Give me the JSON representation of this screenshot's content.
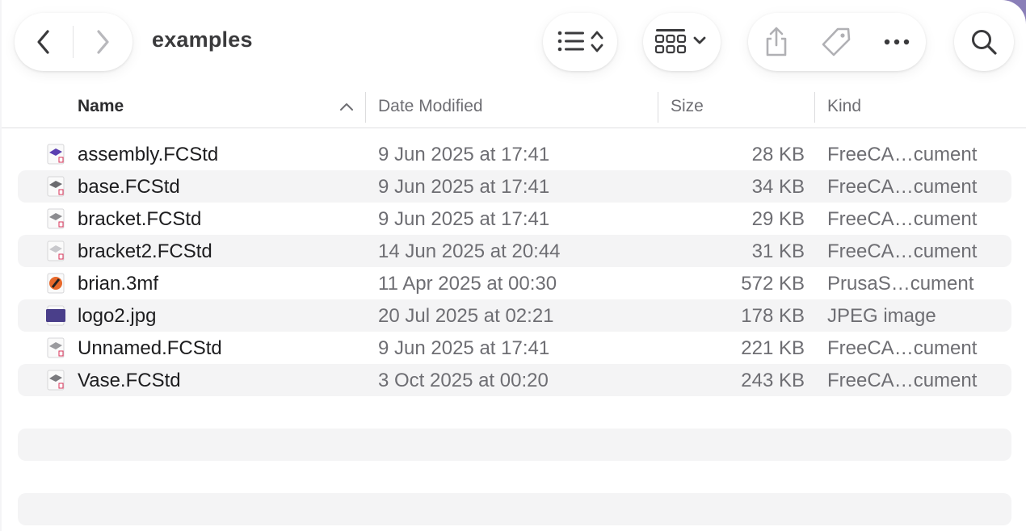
{
  "window": {
    "title": "examples"
  },
  "toolbar": {
    "back_icon": "chevron-left-icon",
    "forward_icon": "chevron-right-icon",
    "view_list_icon": "list-view-icon",
    "view_grid_icon": "grid-view-icon",
    "share_icon": "share-icon",
    "tag_icon": "tag-icon",
    "more_icon": "ellipsis-icon",
    "search_icon": "search-icon"
  },
  "columns": {
    "name": "Name",
    "date": "Date Modified",
    "size": "Size",
    "kind": "Kind"
  },
  "files": [
    {
      "name": "assembly.FCStd",
      "date": "9 Jun 2025 at 17:41",
      "size": "28 KB",
      "kind": "FreeCA…cument",
      "icon": "freecad-file-icon",
      "color": "#5b3fb0"
    },
    {
      "name": "base.FCStd",
      "date": "9 Jun 2025 at 17:41",
      "size": "34 KB",
      "kind": "FreeCA…cument",
      "icon": "freecad-file-icon",
      "color": "#6b6b6f"
    },
    {
      "name": "bracket.FCStd",
      "date": "9 Jun 2025 at 17:41",
      "size": "29 KB",
      "kind": "FreeCA…cument",
      "icon": "freecad-file-icon",
      "color": "#8a8a8e"
    },
    {
      "name": "bracket2.FCStd",
      "date": "14 Jun 2025 at 20:44",
      "size": "31 KB",
      "kind": "FreeCA…cument",
      "icon": "freecad-file-icon",
      "color": "#c8c8cc"
    },
    {
      "name": "brian.3mf",
      "date": "11 Apr 2025 at 00:30",
      "size": "572 KB",
      "kind": "PrusaS…cument",
      "icon": "prusaslicer-file-icon",
      "color": "#e8692b"
    },
    {
      "name": "logo2.jpg",
      "date": "20 Jul 2025 at 02:21",
      "size": "178 KB",
      "kind": "JPEG image",
      "icon": "image-file-icon",
      "color": "#4a3f8a"
    },
    {
      "name": "Unnamed.FCStd",
      "date": "9 Jun 2025 at 17:41",
      "size": "221 KB",
      "kind": "FreeCA…cument",
      "icon": "freecad-file-icon",
      "color": "#9a9a9e"
    },
    {
      "name": "Vase.FCStd",
      "date": "3 Oct 2025 at 00:20",
      "size": "243 KB",
      "kind": "FreeCA…cument",
      "icon": "freecad-file-icon",
      "color": "#7a7a7e"
    }
  ]
}
